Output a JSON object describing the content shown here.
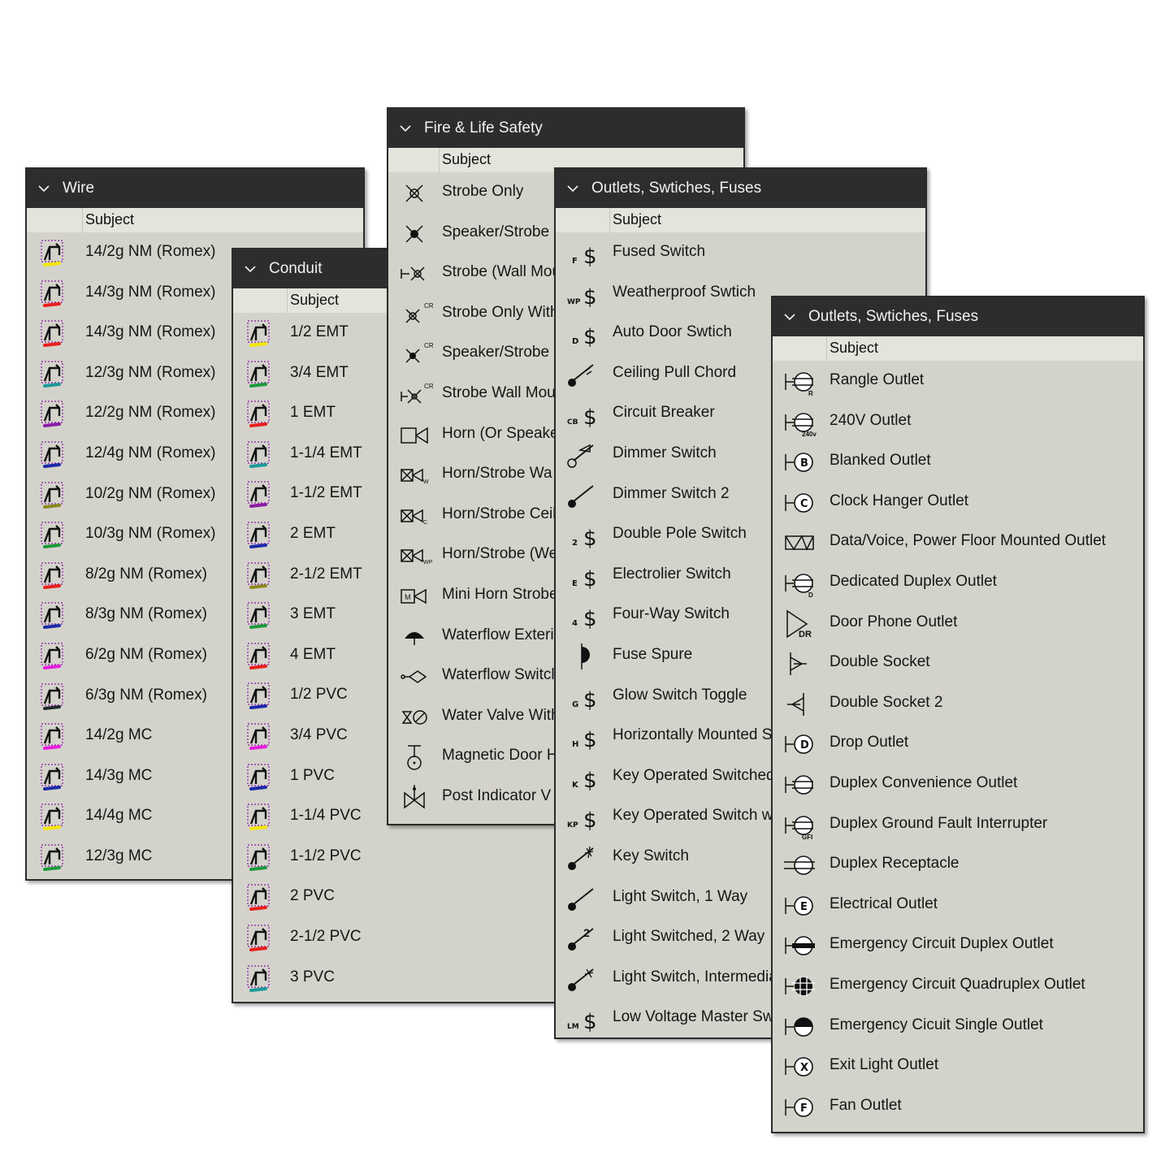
{
  "column_header": "Subject",
  "wire": {
    "title": "Wire",
    "items": [
      {
        "label": "14/2g NM (Romex)",
        "color": "#f2e600"
      },
      {
        "label": "14/3g NM (Romex)",
        "color": "#e8201c"
      },
      {
        "label": "14/3g NM (Romex)",
        "color": "#e8201c"
      },
      {
        "label": "12/3g NM (Romex)",
        "color": "#1c9a9a"
      },
      {
        "label": "12/2g NM (Romex)",
        "color": "#8a1ca8"
      },
      {
        "label": "12/4g NM (Romex)",
        "color": "#1c2aa8"
      },
      {
        "label": "10/2g NM (Romex)",
        "color": "#8a8a1c"
      },
      {
        "label": "10/3g NM (Romex)",
        "color": "#1c9a3a"
      },
      {
        "label": "8/2g NM (Romex)",
        "color": "#e8201c"
      },
      {
        "label": "8/3g NM (Romex)",
        "color": "#1c2aa8"
      },
      {
        "label": "6/2g NM (Romex)",
        "color": "#e81ce0"
      },
      {
        "label": "6/3g NM (Romex)",
        "color": "#1c2a2a"
      },
      {
        "label": "14/2g MC",
        "color": "#e81ce0"
      },
      {
        "label": "14/3g MC",
        "color": "#1c2aa8"
      },
      {
        "label": "14/4g MC",
        "color": "#f2e600"
      },
      {
        "label": "12/3g MC",
        "color": "#1c9a3a"
      }
    ]
  },
  "conduit": {
    "title": "Conduit",
    "items": [
      {
        "label": "1/2 EMT",
        "color": "#f2e600"
      },
      {
        "label": "3/4 EMT",
        "color": "#1c9a3a"
      },
      {
        "label": "1 EMT",
        "color": "#e8201c"
      },
      {
        "label": "1-1/4 EMT",
        "color": "#1c9a9a"
      },
      {
        "label": "1-1/2 EMT",
        "color": "#8a1ca8"
      },
      {
        "label": "2 EMT",
        "color": "#1c2aa8"
      },
      {
        "label": "2-1/2 EMT",
        "color": "#8a8a1c"
      },
      {
        "label": "3 EMT",
        "color": "#1c9a3a"
      },
      {
        "label": "4 EMT",
        "color": "#e8201c"
      },
      {
        "label": "1/2 PVC",
        "color": "#1c2aa8"
      },
      {
        "label": "3/4 PVC",
        "color": "#e81ce0"
      },
      {
        "label": "1 PVC",
        "color": "#1c2aa8"
      },
      {
        "label": "1-1/4 PVC",
        "color": "#f2e600"
      },
      {
        "label": "1-1/2 PVC",
        "color": "#1c9a3a"
      },
      {
        "label": "2 PVC",
        "color": "#e8201c"
      },
      {
        "label": "2-1/2 PVC",
        "color": "#e8201c"
      },
      {
        "label": "3 PVC",
        "color": "#1c9a9a"
      }
    ]
  },
  "fire": {
    "title": "Fire & Life Safety",
    "items": [
      {
        "label": "Strobe Only",
        "icon": "strobe-icon"
      },
      {
        "label": "Speaker/Strobe (",
        "icon": "speaker-strobe-icon"
      },
      {
        "label": "Strobe (Wall Mou",
        "icon": "strobe-wall-icon"
      },
      {
        "label": "Strobe Only With",
        "icon": "strobe-cr-icon"
      },
      {
        "label": "Speaker/Strobe (",
        "icon": "speaker-strobe-cr-icon"
      },
      {
        "label": "Strobe Wall Mou",
        "icon": "strobe-wall-cr-icon"
      },
      {
        "label": "Horn (Or Speake",
        "icon": "horn-icon"
      },
      {
        "label": "Horn/Strobe Wa",
        "icon": "horn-strobe-wall-icon"
      },
      {
        "label": "Horn/Strobe Ceil",
        "icon": "horn-strobe-ceiling-icon"
      },
      {
        "label": "Horn/Strobe (We",
        "icon": "horn-strobe-wp-icon"
      },
      {
        "label": "Mini Horn Strobe",
        "icon": "mini-horn-strobe-icon"
      },
      {
        "label": "Waterflow Exteri",
        "icon": "waterflow-exterior-icon"
      },
      {
        "label": "Waterflow Switcl",
        "icon": "waterflow-switch-icon"
      },
      {
        "label": "Water Valve With",
        "icon": "water-valve-icon"
      },
      {
        "label": "Magnetic Door H",
        "icon": "magnetic-door-icon"
      },
      {
        "label": "Post Indicator V",
        "icon": "post-indicator-icon"
      }
    ]
  },
  "switches": {
    "title": "Outlets, Swtiches, Fuses",
    "items": [
      {
        "label": "Fused Switch",
        "icon": "fused-switch-icon",
        "tag": "F"
      },
      {
        "label": "Weatherproof Swtich",
        "icon": "weatherproof-switch-icon",
        "tag": "WP"
      },
      {
        "label": "Auto Door Swtich",
        "icon": "auto-door-switch-icon",
        "tag": "D"
      },
      {
        "label": "Ceiling Pull Chord",
        "icon": "ceiling-pull-chord-icon",
        "tag": ""
      },
      {
        "label": "Circuit Breaker",
        "icon": "circuit-breaker-icon",
        "tag": "CB"
      },
      {
        "label": "Dimmer Switch",
        "icon": "dimmer-switch-icon",
        "tag": ""
      },
      {
        "label": "Dimmer Switch 2",
        "icon": "dimmer-switch-2-icon",
        "tag": ""
      },
      {
        "label": "Double Pole Switch",
        "icon": "double-pole-switch-icon",
        "tag": "2"
      },
      {
        "label": "Electrolier Switch",
        "icon": "electrolier-switch-icon",
        "tag": "E"
      },
      {
        "label": "Four-Way Switch",
        "icon": "four-way-switch-icon",
        "tag": "4"
      },
      {
        "label": "Fuse Spure",
        "icon": "fuse-spur-icon",
        "tag": ""
      },
      {
        "label": "Glow Switch Toggle",
        "icon": "glow-switch-icon",
        "tag": "G"
      },
      {
        "label": "Horizontally Mounted S",
        "icon": "horizontal-switch-icon",
        "tag": "H"
      },
      {
        "label": "Key Operated Switched",
        "icon": "key-operated-switch-icon",
        "tag": "K"
      },
      {
        "label": "Key Operated Switch w/",
        "icon": "key-operated-pilot-icon",
        "tag": "KP"
      },
      {
        "label": "Key Switch",
        "icon": "key-switch-icon",
        "tag": ""
      },
      {
        "label": "Light Switch, 1 Way",
        "icon": "light-switch-1-way-icon",
        "tag": ""
      },
      {
        "label": "Light Switched, 2 Way",
        "icon": "light-switch-2-way-icon",
        "tag": ""
      },
      {
        "label": "Light Switch, Intermedia",
        "icon": "light-switch-intermediate-icon",
        "tag": ""
      },
      {
        "label": "Low Voltage Master Sw",
        "icon": "low-voltage-master-icon",
        "tag": "LM"
      }
    ]
  },
  "outlets": {
    "title": "Outlets, Swtiches, Fuses",
    "items": [
      {
        "label": "Rangle Outlet",
        "icon": "range-outlet-icon",
        "tag": "R"
      },
      {
        "label": "240V Outlet",
        "icon": "240v-outlet-icon",
        "tag": "240v"
      },
      {
        "label": "Blanked Outlet",
        "icon": "blanked-outlet-icon",
        "tag": "B"
      },
      {
        "label": "Clock Hanger Outlet",
        "icon": "clock-hanger-outlet-icon",
        "tag": "C"
      },
      {
        "label": "Data/Voice, Power Floor Mounted Outlet",
        "icon": "floor-outlet-icon",
        "tag": ""
      },
      {
        "label": "Dedicated Duplex Outlet",
        "icon": "dedicated-duplex-icon",
        "tag": "D"
      },
      {
        "label": "Door Phone Outlet",
        "icon": "door-phone-outlet-icon",
        "tag": "DR"
      },
      {
        "label": "Double Socket",
        "icon": "double-socket-icon",
        "tag": ""
      },
      {
        "label": "Double Socket 2",
        "icon": "double-socket-2-icon",
        "tag": ""
      },
      {
        "label": "Drop Outlet",
        "icon": "drop-outlet-icon",
        "tag": "D"
      },
      {
        "label": "Duplex Convenience Outlet",
        "icon": "duplex-convenience-icon",
        "tag": ""
      },
      {
        "label": "Duplex Ground Fault Interrupter",
        "icon": "gfi-outlet-icon",
        "tag": "GFI"
      },
      {
        "label": "Duplex Receptacle",
        "icon": "duplex-receptacle-icon",
        "tag": ""
      },
      {
        "label": "Electrical Outlet",
        "icon": "electrical-outlet-icon",
        "tag": "E"
      },
      {
        "label": "Emergency Circuit Duplex Outlet",
        "icon": "emergency-duplex-icon",
        "tag": ""
      },
      {
        "label": "Emergency Circuit Quadruplex Outlet",
        "icon": "emergency-quadruplex-icon",
        "tag": ""
      },
      {
        "label": "Emergency Cicuit Single Outlet",
        "icon": "emergency-single-icon",
        "tag": ""
      },
      {
        "label": "Exit Light Outlet",
        "icon": "exit-light-outlet-icon",
        "tag": "X"
      },
      {
        "label": "Fan Outlet",
        "icon": "fan-outlet-icon",
        "tag": "F"
      }
    ]
  }
}
